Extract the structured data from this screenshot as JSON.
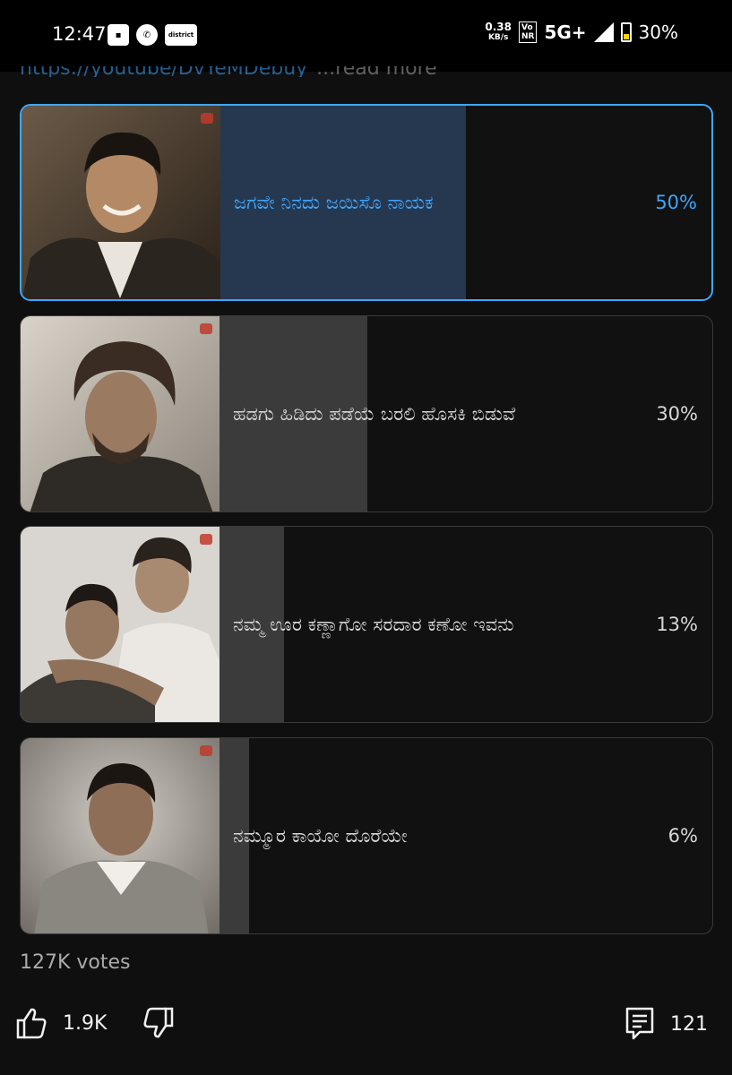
{
  "status_bar": {
    "time": "12:47",
    "left_icons": [
      "remote-icon",
      "phone-icon",
      "district-app-icon"
    ],
    "district_label": "district",
    "net_speed": "0.38",
    "net_speed_unit": "KB/s",
    "volte": "Vo\nNR",
    "network": "5G+",
    "battery": "30%"
  },
  "description_cut": {
    "link_text": "https://youtube/DvYeMDebuy",
    "more_text": "...read more"
  },
  "poll": {
    "options": [
      {
        "label": "ಜಗವೇ ನಿನದು ಜಯಿಸೊ ನಾಯಕ",
        "percent": "50%",
        "fill": 0.5,
        "selected": true
      },
      {
        "label": "ಹಡಗು ಹಿಡಿದು ಪಡೆಯೆ ಬರಲಿ ಹೊಸಕಿ ಬಿಡುವೆ",
        "percent": "30%",
        "fill": 0.3,
        "selected": false
      },
      {
        "label": "ನಮ್ಮ ಊರ ಕಣ್ಣಾಗೋ ಸರದಾರ ಕಣೋ ಇವನು",
        "percent": "13%",
        "fill": 0.13,
        "selected": false
      },
      {
        "label": "ನಮ್ಮೂರ ಕಾಯೋ ದೊರೆಯೇ",
        "percent": "6%",
        "fill": 0.06,
        "selected": false
      }
    ],
    "votes": "127K votes"
  },
  "actions": {
    "likes": "1.9K",
    "comments": "121"
  },
  "colors": {
    "accent": "#3ea6ff",
    "selected_fill": "#263850",
    "fill": "#3b3b3b",
    "background": "#0f0f0f"
  }
}
